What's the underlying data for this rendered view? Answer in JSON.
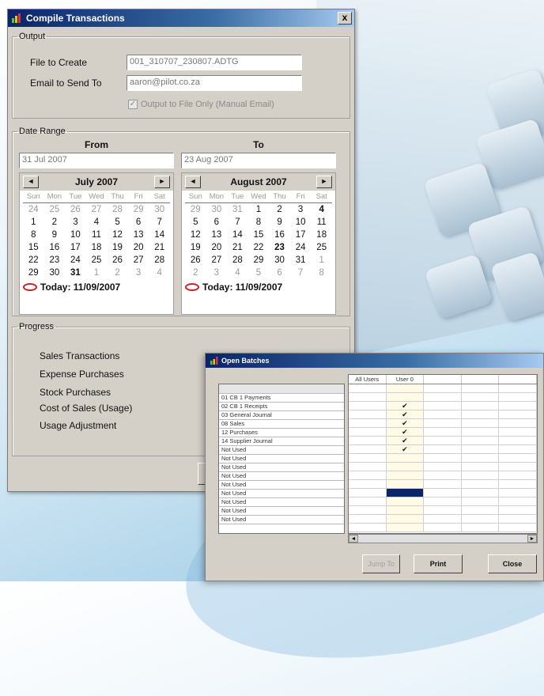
{
  "compile_dialog": {
    "title": "Compile Transactions",
    "close_glyph": "x",
    "output": {
      "legend": "Output",
      "file_label": "File to Create",
      "file_value": "001_310707_230807.ADTG",
      "email_label": "Email to Send To",
      "email_value": "aaron@pilot.co.za",
      "checkbox_label": "Output to File Only (Manual Email)",
      "checkbox_checked": true
    },
    "date_range": {
      "legend": "Date Range",
      "from_label": "From",
      "to_label": "To",
      "from_value": "31 Jul 2007",
      "to_value": "23 Aug 2007",
      "prev_glyph": "◄",
      "next_glyph": "►",
      "weekdays": [
        "Sun",
        "Mon",
        "Tue",
        "Wed",
        "Thu",
        "Fri",
        "Sat"
      ],
      "today_text": "Today: 11/09/2007",
      "from_calendar": {
        "title": "July 2007",
        "days": [
          "24",
          "25",
          "26",
          "27",
          "28",
          "29",
          "30",
          "1",
          "2",
          "3",
          "4",
          "5",
          "6",
          "7",
          "8",
          "9",
          "10",
          "11",
          "12",
          "13",
          "14",
          "15",
          "16",
          "17",
          "18",
          "19",
          "20",
          "21",
          "22",
          "23",
          "24",
          "25",
          "26",
          "27",
          "28",
          "29",
          "30",
          "31",
          "1",
          "2",
          "3",
          "4"
        ],
        "first_current_index": 7,
        "last_current_index": 37,
        "selected_index": 37
      },
      "to_calendar": {
        "title": "August 2007",
        "days": [
          "29",
          "30",
          "31",
          "1",
          "2",
          "3",
          "4",
          "5",
          "6",
          "7",
          "8",
          "9",
          "10",
          "11",
          "12",
          "13",
          "14",
          "15",
          "16",
          "17",
          "18",
          "19",
          "20",
          "21",
          "22",
          "23",
          "24",
          "25",
          "26",
          "27",
          "28",
          "29",
          "30",
          "31",
          "1",
          "2",
          "3",
          "4",
          "5",
          "6",
          "7",
          "8"
        ],
        "first_current_index": 3,
        "last_current_index": 33,
        "selected_index": 25,
        "bold_index": 6
      }
    },
    "progress": {
      "legend": "Progress",
      "items": [
        "Sales Transactions",
        "Expense Purchases",
        "Stock Purchases",
        "Cost of Sales (Usage)",
        "Usage Adjustment"
      ]
    }
  },
  "open_batches_dialog": {
    "title": "Open Batches",
    "columns": [
      "All Users",
      "User 0",
      "",
      "",
      ""
    ],
    "batches": [
      "01 CB 1 Payments",
      "02 CB 1 Receipts",
      "03 General Journal",
      "08 Sales",
      "12 Purchases",
      "14 Supplier Journal",
      "Not Used",
      "Not Used",
      "Not Used",
      "Not Used",
      "Not Used",
      "Not Used",
      "Not Used",
      "Not Used",
      "Not Used"
    ],
    "checked_rows": [
      0,
      1,
      2,
      3,
      4,
      5
    ],
    "check_glyph": "✔",
    "scroll_left_glyph": "◄",
    "scroll_right_glyph": "►",
    "buttons": {
      "jump": "Jump To",
      "print": "Print",
      "close": "Close"
    }
  },
  "colors": {
    "title_start": "#0a246a",
    "title_end": "#a6caf0",
    "today_marker": "#d21e1e",
    "highlight": "#0a246a"
  }
}
